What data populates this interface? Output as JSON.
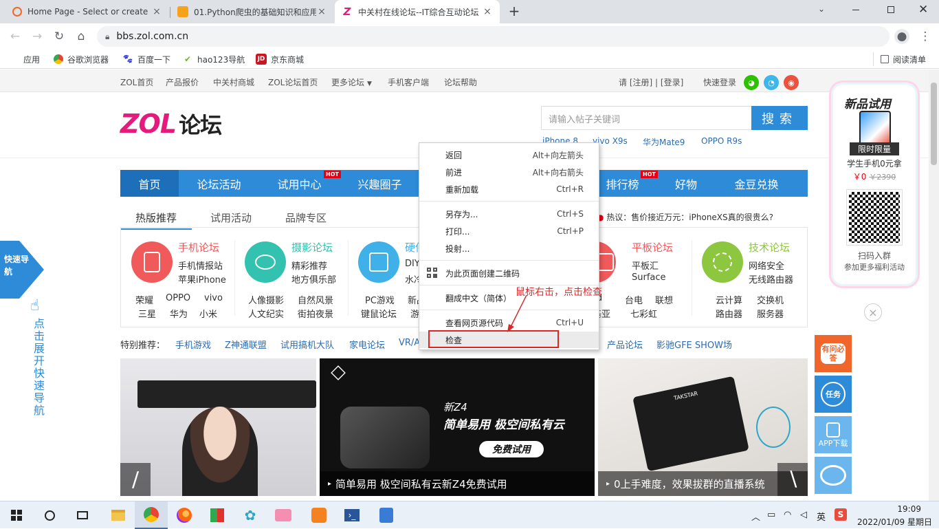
{
  "browser": {
    "tabs": [
      {
        "title": "Home Page - Select or create",
        "favicon": "O",
        "active": false
      },
      {
        "title": "01.Python爬虫的基础知识和应用",
        "favicon": "▮",
        "active": false
      },
      {
        "title": "中关村在线论坛--IT综合互动论坛",
        "favicon": "Z",
        "active": true
      }
    ],
    "new_tab_glyph": "+",
    "url": "bbs.zol.com.cn",
    "bookmarks": [
      {
        "label": "应用",
        "icon": "apps-grid-icon"
      },
      {
        "label": "谷歌浏览器",
        "icon": "chrome-icon"
      },
      {
        "label": "百度一下",
        "icon": "baidu-icon"
      },
      {
        "label": "hao123导航",
        "icon": "hao123-icon"
      },
      {
        "label": "京东商城",
        "icon": "jd-icon"
      }
    ],
    "reading_list": "阅读清单"
  },
  "site": {
    "topnav": [
      "ZOL首页",
      "产品报价",
      "中关村商城",
      "ZOL论坛首页",
      "更多论坛",
      "手机客户端",
      "论坛帮助"
    ],
    "login": {
      "prefix": "请 [",
      "register": "注册",
      "mid": "] | [",
      "login": "登录",
      "suffix": "]"
    },
    "quick_login": "快速登录",
    "logo_brand": "ZOL",
    "logo_text": "论坛",
    "search_placeholder": "请输入帖子关键词",
    "search_button": "搜索",
    "hot_keywords": [
      "iPhone 8",
      "vivo X9s",
      "华为Mate9",
      "OPPO R9s"
    ],
    "mainnav": [
      {
        "label": "首页",
        "hot": false
      },
      {
        "label": "论坛活动",
        "hot": false
      },
      {
        "label": "试用中心",
        "hot": true
      },
      {
        "label": "兴趣圈子",
        "hot": false
      },
      {
        "label": "排行榜",
        "hot": true
      },
      {
        "label": "好物",
        "hot": false
      },
      {
        "label": "金豆兑换",
        "hot": false
      }
    ],
    "hot_label": "HOT",
    "subtabs": [
      "热版推荐",
      "试用活动",
      "品牌专区"
    ],
    "hot_discussion": "热议：售价接近万元：iPhoneXS真的很贵么?",
    "forums": [
      {
        "title": "手机论坛",
        "color": "#f05a5a",
        "lines": [
          "手机情报站",
          "苹果iPhone"
        ],
        "links": [
          [
            "荣耀",
            "OPPO",
            "vivo"
          ],
          [
            "三星",
            "华为",
            "小米"
          ]
        ]
      },
      {
        "title": "摄影论坛",
        "color": "#33c2b0",
        "lines": [
          "精彩推荐",
          "地方俱乐部"
        ],
        "links": [
          [
            "人像摄影",
            "自然风景"
          ],
          [
            "人文纪实",
            "街拍夜景"
          ]
        ]
      },
      {
        "title": "硬件论坛",
        "color": "#3fb0e8",
        "lines": [
          "DIY",
          "水冷"
        ],
        "links": [
          [
            "PC游戏",
            "新品"
          ],
          [
            "键鼠论坛",
            "游戏"
          ]
        ]
      },
      {
        "title": "平板论坛",
        "color": "#f05a5a",
        "lines": [
          "平板汇",
          "Surface"
        ],
        "links": [
          [
            "iPad",
            "台电",
            "联想"
          ],
          [
            "诺基亚",
            "七彩虹"
          ]
        ]
      },
      {
        "title": "技术论坛",
        "color": "#8dc63f",
        "lines": [
          "网络安全",
          "无线路由器"
        ],
        "links": [
          [
            "云计算",
            "交换机"
          ],
          [
            "路由器",
            "服务器"
          ]
        ]
      }
    ],
    "special_label": "特别推荐：",
    "special_links": [
      "手机游戏",
      "Z神通联盟",
      "试用搞机大队",
      "家电论坛",
      "VR/A",
      "产品论坛",
      "影驰GFE SHOW场"
    ],
    "banners": [
      {
        "caption": ""
      },
      {
        "caption": "简单易用 极空间私有云新Z4免费试用",
        "product_name": "新Z4",
        "slogan": "简单易用 极空间私有云",
        "cta": "免费试用"
      },
      {
        "caption": "0上手难度，效果拔群的直播系统",
        "brand": "TAKSTAR"
      }
    ],
    "quick_nav": "快速导航",
    "expand_text": "点击展开快速导航",
    "promo": {
      "title": "新品试用",
      "badge": "限时限量",
      "desc": "学生手机0元拿",
      "price": "￥0",
      "old_price": "￥2390",
      "scan": "扫码入群",
      "scan_sub": "参加更多福利活动"
    },
    "close_glyph": "×",
    "side_buttons": [
      "有问必答",
      "任务",
      "APP下载",
      "微博"
    ]
  },
  "context_menu": {
    "groups": [
      [
        {
          "label": "返回",
          "shortcut": "Alt+向左箭头"
        },
        {
          "label": "前进",
          "shortcut": "Alt+向右箭头"
        },
        {
          "label": "重新加载",
          "shortcut": "Ctrl+R"
        }
      ],
      [
        {
          "label": "另存为...",
          "shortcut": "Ctrl+S"
        },
        {
          "label": "打印...",
          "shortcut": "Ctrl+P"
        },
        {
          "label": "投射...",
          "shortcut": ""
        }
      ],
      [
        {
          "label": "为此页面创建二维码",
          "shortcut": ""
        }
      ],
      [
        {
          "label": "翻成中文（简体）",
          "shortcut": ""
        }
      ],
      [
        {
          "label": "查看网页源代码",
          "shortcut": "Ctrl+U"
        },
        {
          "label": "检查",
          "shortcut": ""
        }
      ]
    ]
  },
  "annotation": "鼠标右击，点击检查",
  "taskbar": {
    "ime": "英",
    "time": "19:09",
    "date": "2022/01/09 星期日"
  }
}
